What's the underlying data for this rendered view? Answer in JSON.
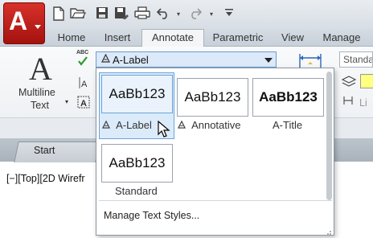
{
  "quick_access": {
    "icons": [
      "new-icon",
      "open-icon",
      "save-icon",
      "save-as-icon",
      "plot-icon",
      "undo-icon",
      "redo-icon",
      "customize-icon"
    ]
  },
  "ribbon_tabs": [
    {
      "label": "Home",
      "active": false
    },
    {
      "label": "Insert",
      "active": false
    },
    {
      "label": "Annotate",
      "active": true
    },
    {
      "label": "Parametric",
      "active": false
    },
    {
      "label": "View",
      "active": false
    },
    {
      "label": "Manage",
      "active": false
    }
  ],
  "text_panel": {
    "multiline_label_line1": "Multiline",
    "multiline_label_line2": "Text",
    "big_icon_glyph": "A",
    "spell_abc": "ABC"
  },
  "text_style_combo": {
    "value": "A-Label"
  },
  "right_panel": {
    "standard_value": "Standa",
    "linear_label": "Li"
  },
  "gallery": {
    "items": [
      {
        "preview": "AaBb123",
        "label": "A-Label",
        "annotative": true,
        "bold": false,
        "selected": true
      },
      {
        "preview": "AaBb123",
        "label": "Annotative",
        "annotative": true,
        "bold": false,
        "selected": false
      },
      {
        "preview": "AaBb123",
        "label": "A-Title",
        "annotative": false,
        "bold": true,
        "selected": false
      },
      {
        "preview": "AaBb123",
        "label": "Standard",
        "annotative": false,
        "bold": false,
        "selected": false
      }
    ],
    "manage_label": "Manage Text Styles..."
  },
  "doc_tabs": {
    "start_label": "Start"
  },
  "viewport": {
    "controls_text": "[−][Top][2D Wirefr"
  },
  "colors": {
    "app_button": "#c01d16",
    "selection": "#dcebfa",
    "selection_border": "#6aa3d8"
  }
}
